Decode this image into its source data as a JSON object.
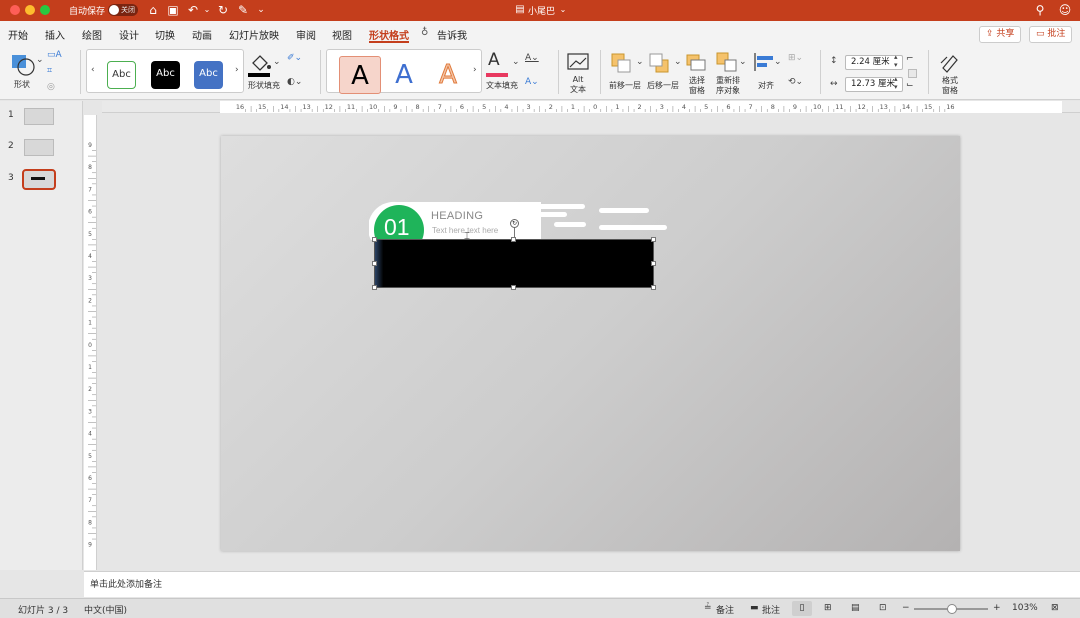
{
  "window": {
    "autosave_label": "自动保存",
    "autosave_state": "关闭",
    "doc_title": "小尾巴"
  },
  "menu": {
    "tabs": [
      "开始",
      "插入",
      "绘图",
      "设计",
      "切换",
      "动画",
      "幻灯片放映",
      "审阅",
      "视图",
      "形状格式"
    ],
    "tell_me": "告诉我",
    "share": "共享",
    "comments": "批注"
  },
  "ribbon": {
    "shape_label": "形状",
    "style_samples": [
      "Abc",
      "Abc",
      "Abc"
    ],
    "shape_fill_label": "形状填充",
    "wordart_samples": [
      "A",
      "A",
      "A"
    ],
    "text_fill_label": "文本填充",
    "alt_text_label": "Alt\n文本",
    "bring_forward_label": "前移一层",
    "send_backward_label": "后移一层",
    "selection_pane_label": "选择\n窗格",
    "reorder_label": "重新排\n序对象",
    "align_label": "对齐",
    "height_value": "2.24 厘米",
    "width_value": "12.73 厘米",
    "format_pane_label": "格式\n窗格"
  },
  "ruler": {
    "h_ticks": [
      "16",
      "15",
      "14",
      "13",
      "12",
      "11",
      "10",
      "9",
      "8",
      "7",
      "6",
      "5",
      "4",
      "3",
      "2",
      "1",
      "0",
      "1",
      "2",
      "3",
      "4",
      "5",
      "6",
      "7",
      "8",
      "9",
      "10",
      "11",
      "12",
      "13",
      "14",
      "15",
      "16"
    ],
    "v_ticks": [
      "9",
      "8",
      "7",
      "6",
      "5",
      "4",
      "3",
      "2",
      "1",
      "0",
      "1",
      "2",
      "3",
      "4",
      "5",
      "6",
      "7",
      "8",
      "9"
    ]
  },
  "slides": {
    "numbers": [
      "1",
      "2",
      "3"
    ],
    "selected": 3
  },
  "slide": {
    "badge_number": "01",
    "heading": "HEADING",
    "subtext": "Text here text here"
  },
  "notes_placeholder": "单击此处添加备注",
  "status": {
    "slide_counter": "幻灯片 3 / 3",
    "language": "中文(中国)",
    "notes_btn": "备注",
    "comments_btn": "批注",
    "zoom": "103%",
    "zoom_level": 0.52
  },
  "colors": {
    "accent": "#c43e1c",
    "badge_green": "#1fb45a",
    "selected_shape": "#000000"
  }
}
